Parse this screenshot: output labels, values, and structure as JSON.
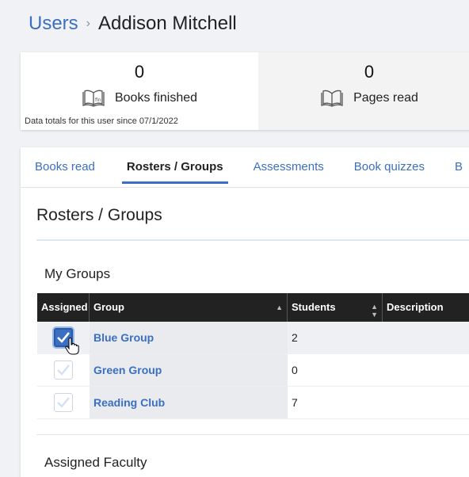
{
  "breadcrumb": {
    "parent": "Users",
    "separator": "›",
    "current": "Addison Mitchell"
  },
  "stats": {
    "books_finished": {
      "value": "0",
      "label": "Books finished",
      "icon": "book-finished-icon"
    },
    "pages_read": {
      "value": "0",
      "label": "Pages read",
      "icon": "open-book-icon"
    },
    "note": "Data totals for this user since 07/1/2022"
  },
  "tabs": [
    {
      "label": "Books read"
    },
    {
      "label": "Rosters / Groups",
      "active": true
    },
    {
      "label": "Assessments"
    },
    {
      "label": "Book quizzes"
    },
    {
      "label": "B"
    }
  ],
  "section": {
    "title": "Rosters / Groups",
    "my_groups": "My Groups",
    "assigned_faculty": "Assigned Faculty"
  },
  "table": {
    "headers": [
      "Assigned",
      "Group",
      "Students",
      "Description"
    ],
    "rows": [
      {
        "assigned": true,
        "group": "Blue Group",
        "students": "2",
        "description": ""
      },
      {
        "assigned": false,
        "group": "Green Group",
        "students": "0",
        "description": ""
      },
      {
        "assigned": false,
        "group": "Reading Club",
        "students": "7",
        "description": ""
      }
    ]
  },
  "colors": {
    "accent": "#3b6fc1",
    "header_bg": "#222222",
    "page_bg": "#f0f2f5"
  }
}
